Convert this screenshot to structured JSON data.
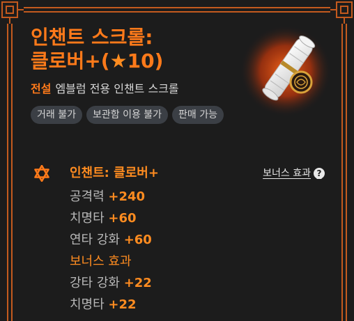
{
  "item": {
    "title_line1": "인챈트 스크롤:",
    "title_line2_pre": "클로버+(",
    "title_star": "★",
    "title_line2_num": "10",
    "title_line2_post": ")",
    "grade": "전설",
    "type": "엠블럼 전용 인챈트 스크롤",
    "tags": [
      "거래 불가",
      "보관함 이용 불가",
      "판매 가능"
    ],
    "image_icon": "scroll-emblem-icon"
  },
  "effect": {
    "icon": "hexagram-star-icon",
    "title": "인챈트: 클로버+",
    "bonus_link": "보너스 효과",
    "help_glyph": "?",
    "stats": [
      {
        "label": "공격력 ",
        "value": "+240"
      },
      {
        "label": "치명타 ",
        "value": "+60"
      },
      {
        "label": "연타 강화 ",
        "value": "+60"
      }
    ],
    "bonus_heading": "보너스 효과",
    "bonus_stats": [
      {
        "label": "강타 강화 ",
        "value": "+22"
      },
      {
        "label": "치명타 ",
        "value": "+22"
      }
    ]
  },
  "colors": {
    "accent": "#ff7a1a",
    "border": "#c45a1e",
    "background": "#1c1c1c",
    "tag_bg": "#3b3f45"
  }
}
